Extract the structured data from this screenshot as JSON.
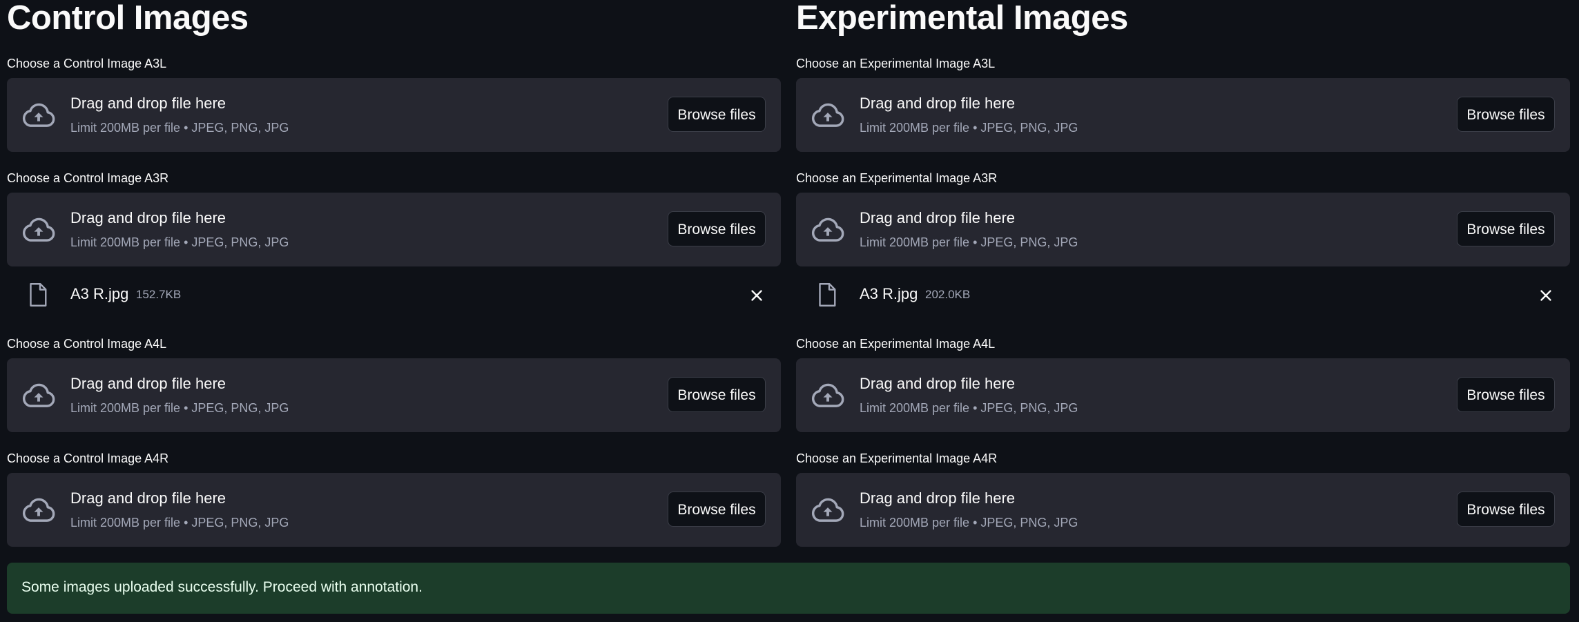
{
  "control": {
    "heading": "Control Images",
    "fields": [
      {
        "label": "Choose a Control Image A3L"
      },
      {
        "label": "Choose a Control Image A3R",
        "file": {
          "name": "A3 R.jpg",
          "size": "152.7KB"
        }
      },
      {
        "label": "Choose a Control Image A4L"
      },
      {
        "label": "Choose a Control Image A4R"
      }
    ]
  },
  "experimental": {
    "heading": "Experimental Images",
    "fields": [
      {
        "label": "Choose an Experimental Image A3L"
      },
      {
        "label": "Choose an Experimental Image A3R",
        "file": {
          "name": "A3 R.jpg",
          "size": "202.0KB"
        }
      },
      {
        "label": "Choose an Experimental Image A4L"
      },
      {
        "label": "Choose an Experimental Image A4R"
      }
    ]
  },
  "uploader": {
    "title": "Drag and drop file here",
    "hint": "Limit 200MB per file • JPEG, PNG, JPG",
    "browse_label": "Browse files"
  },
  "success_message": "Some images uploaded successfully. Proceed with annotation.",
  "icons": {
    "upload": "cloud-upload-icon",
    "file": "file-icon",
    "close": "close-icon"
  },
  "colors": {
    "background": "#0e1117",
    "dropzone": "#262730",
    "success_bg": "#1c3d2a"
  }
}
